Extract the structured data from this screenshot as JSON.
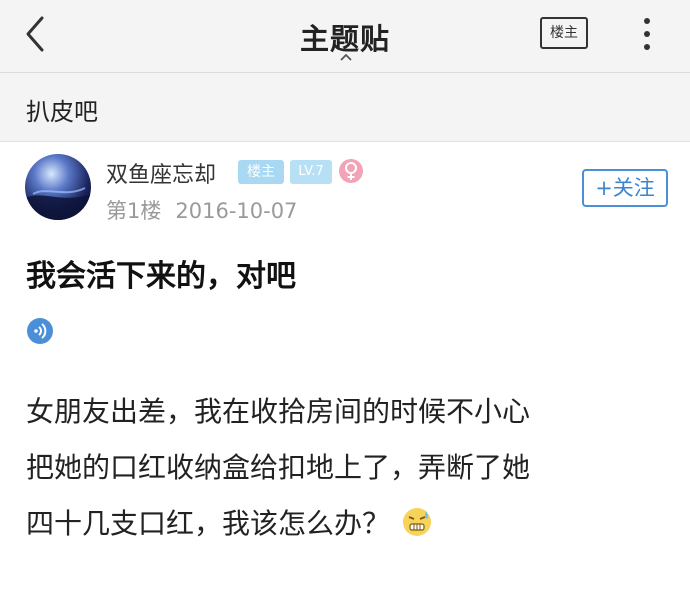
{
  "header": {
    "title": "主题贴",
    "lz_button_label": "楼主"
  },
  "forum": {
    "name": "扒皮吧"
  },
  "post": {
    "author": "双鱼座忘却",
    "author_badge": "楼主",
    "level_badge": "LV.7",
    "floor": "第1楼",
    "date": "2016-10-07",
    "follow_label": "+关注",
    "title": "我会活下来的，对吧",
    "body_lines": [
      "女朋友出差，我在收拾房间的时候不小心",
      "把她的口红收纳盒给扣地上了，弄断了她",
      "四十几支口红，我该怎么办？"
    ]
  },
  "colors": {
    "accent_blue": "#3b84d4",
    "badge_blue": "#a8d8f2",
    "gender_pink": "#f2a3b8",
    "bar_bg": "#f4f4f4"
  },
  "icons": {
    "back": "chevron-left-icon",
    "more": "vertical-dots-icon",
    "gender": "female-icon",
    "voice": "voice-icon",
    "emoji": "cold-sweat-emoji-icon"
  }
}
